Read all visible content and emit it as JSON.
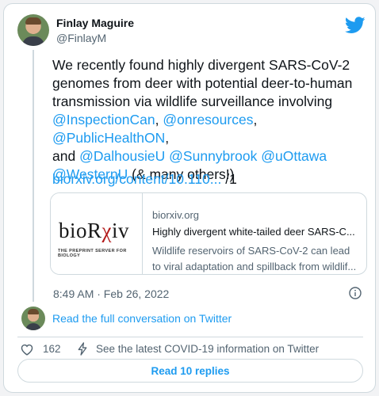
{
  "author": {
    "name": "Finlay Maguire",
    "handle": "@FinlayM"
  },
  "tweet": {
    "line1": "We recently found highly divergent SARS-CoV-2",
    "line2": "genomes from deer with potential deer-to-human",
    "line3": "transmission via wildlife surveillance involving",
    "mention1": "@InspectionCan",
    "sep1": ", ",
    "mention2": "@onresources",
    "sep2": ", ",
    "mention3": "@PublicHealthON",
    "sep3": ",",
    "and_word": "and ",
    "mention4": "@DalhousieU",
    "mention5": "@Sunnybrook",
    "mention6": "@uOttawa",
    "mention7": "@WesternU",
    "closing": " (& many others!)",
    "link": "biorxiv.org/content/10.110...",
    "link_suffix": " /1"
  },
  "preview": {
    "logo_part1": "bioR",
    "logo_part2": "χ",
    "logo_part3": "iv",
    "logo_tagline": "THE PREPRINT SERVER FOR BIOLOGY",
    "site": "biorxiv.org",
    "title": "Highly divergent white-tailed deer SARS-C...",
    "desc_line1": "Wildlife reservoirs of SARS-CoV-2 can lead",
    "desc_line2": "to viral adaptation and spillback from wildlif..."
  },
  "meta": {
    "timestamp": "8:49 AM · Feb 26, 2022"
  },
  "conversation": {
    "link_label": "Read the full conversation on Twitter"
  },
  "actions": {
    "like_count": "162",
    "covid_info": "See the latest COVID-19 information on Twitter"
  },
  "replies_button": "Read 10 replies",
  "colors": {
    "accent": "#1d9bf0",
    "text": "#0f1419",
    "secondary": "#536471",
    "border": "#cfd9de"
  },
  "icons": [
    "twitter-bird-icon",
    "info-icon",
    "heart-icon",
    "lightning-bolt-icon"
  ]
}
